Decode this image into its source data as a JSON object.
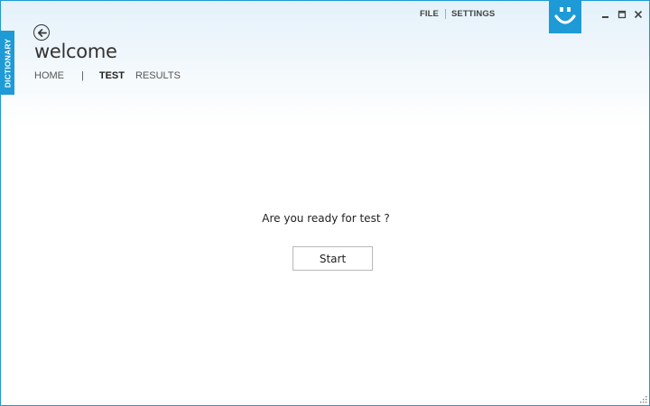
{
  "side_tab": {
    "label": "DICTIONARY"
  },
  "header": {
    "title": "welcome",
    "back_icon": "arrow-left-circle-icon"
  },
  "nav": {
    "items": [
      {
        "label": "HOME",
        "active": false
      },
      {
        "label": "TEST",
        "active": true
      },
      {
        "label": "RESULTS",
        "active": false
      }
    ],
    "separator": "|"
  },
  "top_menu": {
    "file_label": "FILE",
    "settings_label": "SETTINGS"
  },
  "logo": {
    "icon": "smiley-icon",
    "color": "#1e9ad6"
  },
  "window_controls": {
    "minimize_icon": "minimize-icon",
    "maximize_icon": "maximize-icon",
    "close_icon": "close-icon"
  },
  "main": {
    "question": "Are you ready for test ?",
    "start_label": "Start"
  },
  "colors": {
    "accent": "#1e9ad6",
    "text": "#333333",
    "button_border": "#b8b8b8"
  }
}
